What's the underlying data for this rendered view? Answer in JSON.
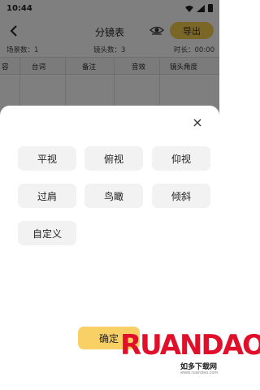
{
  "status_bar": {
    "time": "10:44"
  },
  "header": {
    "title": "分镜表",
    "export_label": "导出"
  },
  "meta": {
    "storyboard_count": "场景数：1",
    "shot_count": "镜头数：3",
    "duration": "时长：00:00"
  },
  "table": {
    "columns": [
      "容",
      "台词",
      "备注",
      "音效",
      "镜头角度"
    ]
  },
  "dialog": {
    "options": [
      "平视",
      "俯视",
      "仰视",
      "过肩",
      "鸟瞰",
      "倾斜",
      "自定义"
    ],
    "confirm_label": "确定"
  },
  "watermark": {
    "brand": "RUANDAO",
    "tagline": "如多下载网",
    "url": "www.ruandao.com"
  },
  "colors": {
    "accent": "#f5cc4e",
    "confirm": "#f8d066",
    "brand_red": "#e0102b"
  }
}
